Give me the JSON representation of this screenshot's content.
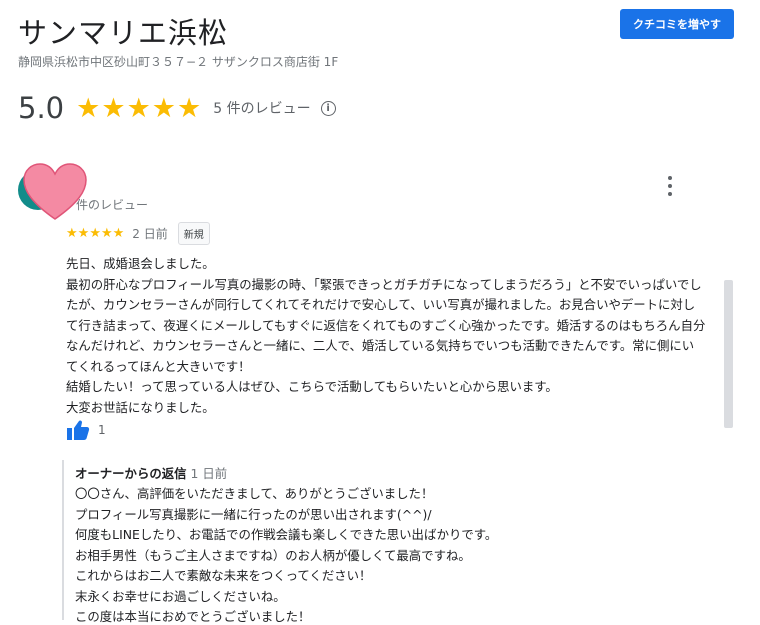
{
  "place": {
    "name": "サンマリエ浜松",
    "address": "静岡県浜松市中区砂山町３５７−２ サザンクロス商店街 1F"
  },
  "header": {
    "write_review_label": "クチコミを増やす"
  },
  "summary": {
    "rating": "5.0",
    "stars": 5,
    "review_count_label": "5 件のレビュー",
    "info_icon": "info-icon"
  },
  "review": {
    "reviewer_meta": "件のレビュー",
    "stars": 5,
    "date": "2 日前",
    "badge": "新規",
    "text": "先日、成婚退会しました。\n最初の肝心なプロフィール写真の撮影の時、「緊張できっとガチガチになってしまうだろう」と不安でいっぱいでしたが、カウンセラーさんが同行してくれてそれだけで安心して、いい写真が撮れました。お見合いやデートに対して行き詰まって、夜遅くにメールしてもすぐに返信をくれてものすごく心強かったです。婚活するのはもちろん自分なんだけれど、カウンセラーさんと一緒に、二人で、婚活している気持ちでいつも活動できたんです。常に側にいてくれるってほんと大きいです！\n結婚したい！って思っている人はぜひ、こちらで活動してもらいたいと心から思います。\n大変お世話になりました。",
    "likes": "1"
  },
  "owner_reply": {
    "label": "オーナーからの返信",
    "date": "1 日前",
    "text": "〇〇さん、高評価をいただきまして、ありがとうございました！\nプロフィール写真撮影に一緒に行ったのが思い出されます(^^)/\n何度もLINEしたり、お電話での作戦会議も楽しくできた思い出ばかりです。\nお相手男性（もうご主人さまですね）のお人柄が優しくて最高ですね。\nこれからはお二人で素敵な未来をつくってください！\n末永くお幸せにお過ごしくださいね。\nこの度は本当におめでとうございました！"
  },
  "colors": {
    "accent": "#1a73e8",
    "star": "#fbbc04",
    "avatar": "#128c8a",
    "heart": "#f48aa3"
  }
}
